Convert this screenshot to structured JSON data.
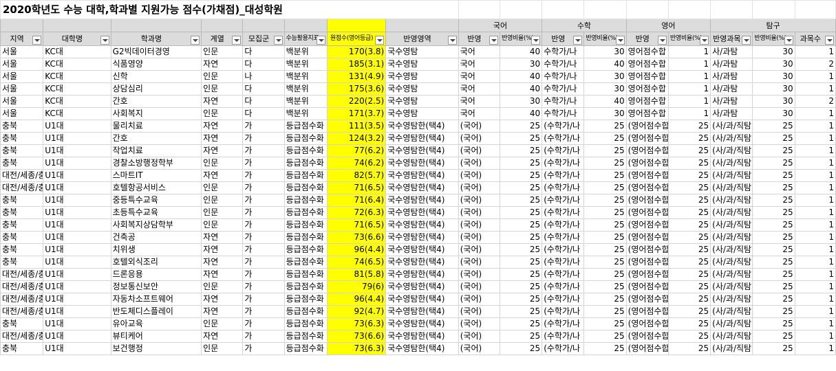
{
  "title": "2020학년도 수능 대학,학과별 지원가능 점수(가채점)_대성학원",
  "group_headers": {
    "korean": "국어",
    "math": "수학",
    "english": "영어",
    "inquiry": "탐구"
  },
  "column_headers": {
    "region": "지역",
    "university": "대학명",
    "department": "학과명",
    "track": "계열",
    "group": "모집군",
    "csat_index": "수능활용지표",
    "raw_score": "원점수(영어등급)",
    "reflected_areas": "반영영역",
    "kor_reflect": "반영",
    "kor_ratio": "반영비율(%)",
    "math_reflect": "반영",
    "math_ratio": "반영비율(%)",
    "eng_reflect": "반영",
    "eng_ratio": "반영비율(%)",
    "inq_subject": "반영과목",
    "inq_ratio": "반영비율(%)",
    "inq_count": "과목수"
  },
  "rows": [
    [
      "서울",
      "KC대",
      "G2빅데이터경영",
      "인문",
      "다",
      "백분위",
      "170(3.8)",
      "국수영탐",
      "국어",
      "40",
      "수학가/나",
      "30",
      "영어점수합",
      "1",
      "사/과탐",
      "30",
      "1"
    ],
    [
      "서울",
      "KC대",
      "식품영양",
      "자연",
      "다",
      "백분위",
      "185(3.1)",
      "국수영탐",
      "국어",
      "30",
      "수학가/나",
      "40",
      "영어점수합",
      "1",
      "사/과탐",
      "30",
      "2"
    ],
    [
      "서울",
      "KC대",
      "신학",
      "인문",
      "나",
      "백분위",
      "131(4.9)",
      "국수영탐",
      "국어",
      "40",
      "수학가/나",
      "30",
      "영어점수합",
      "1",
      "사/과탐",
      "30",
      "1"
    ],
    [
      "서울",
      "KC대",
      "상담심리",
      "인문",
      "다",
      "백분위",
      "175(3.6)",
      "국수영탐",
      "국어",
      "40",
      "수학가/나",
      "30",
      "영어점수합",
      "1",
      "사/과탐",
      "30",
      "1"
    ],
    [
      "서울",
      "KC대",
      "간호",
      "자연",
      "다",
      "백분위",
      "220(2.5)",
      "국수영탐",
      "국어",
      "30",
      "수학가/나",
      "40",
      "영어점수합",
      "1",
      "사/과탐",
      "30",
      "2"
    ],
    [
      "서울",
      "KC대",
      "사회복지",
      "인문",
      "다",
      "백분위",
      "171(3.7)",
      "국수영탐",
      "국어",
      "40",
      "수학가/나",
      "30",
      "영어점수합",
      "1",
      "사/과탐",
      "30",
      "1"
    ],
    [
      "충북",
      "U1대",
      "물리치료",
      "자연",
      "가",
      "등급점수화",
      "111(3.5)",
      "국수영탐한(택4)",
      "(국어)",
      "25",
      "(수학가/나",
      "25",
      "(영어점수합",
      "25",
      "(사/과/직탐",
      "25",
      "1"
    ],
    [
      "충북",
      "U1대",
      "간호",
      "자연",
      "가",
      "등급점수화",
      "124(3.2)",
      "국수영탐한(택4)",
      "(국어)",
      "25",
      "(수학가/나",
      "25",
      "(영어점수합",
      "25",
      "(사/과/직탐",
      "25",
      "1"
    ],
    [
      "충북",
      "U1대",
      "작업치료",
      "자연",
      "가",
      "등급점수화",
      "77(6.2)",
      "국수영탐한(택4)",
      "(국어)",
      "25",
      "(수학가/나",
      "25",
      "(영어점수합",
      "25",
      "(사/과/직탐",
      "25",
      "1"
    ],
    [
      "충북",
      "U1대",
      "경찰소방행정학부",
      "인문",
      "가",
      "등급점수화",
      "74(6.2)",
      "국수영탐한(택4)",
      "(국어)",
      "25",
      "(수학가/나",
      "25",
      "(영어점수합",
      "25",
      "(사/과/직탐",
      "25",
      "1"
    ],
    [
      "대전/세종/충남",
      "U1대",
      "스마트IT",
      "자연",
      "가",
      "등급점수화",
      "82(5.7)",
      "국수영탐한(택4)",
      "(국어)",
      "25",
      "(수학가/나",
      "25",
      "(영어점수합",
      "25",
      "(사/과/직탐",
      "25",
      "1"
    ],
    [
      "대전/세종/충남",
      "U1대",
      "호텔항공서비스",
      "인문",
      "가",
      "등급점수화",
      "71(6.5)",
      "국수영탐한(택4)",
      "(국어)",
      "25",
      "(수학가/나",
      "25",
      "(영어점수합",
      "25",
      "(사/과/직탐",
      "25",
      "1"
    ],
    [
      "충북",
      "U1대",
      "중등특수교육",
      "인문",
      "가",
      "등급점수화",
      "71(6.4)",
      "국수영탐한(택4)",
      "(국어)",
      "25",
      "(수학가/나",
      "25",
      "(영어점수합",
      "25",
      "(사/과/직탐",
      "25",
      "1"
    ],
    [
      "충북",
      "U1대",
      "초등특수교육",
      "인문",
      "가",
      "등급점수화",
      "72(6.3)",
      "국수영탐한(택4)",
      "(국어)",
      "25",
      "(수학가/나",
      "25",
      "(영어점수합",
      "25",
      "(사/과/직탐",
      "25",
      "1"
    ],
    [
      "충북",
      "U1대",
      "사회복지상담학부",
      "인문",
      "가",
      "등급점수화",
      "71(6.5)",
      "국수영탐한(택4)",
      "(국어)",
      "25",
      "(수학가/나",
      "25",
      "(영어점수합",
      "25",
      "(사/과/직탐",
      "25",
      "1"
    ],
    [
      "충북",
      "U1대",
      "건축공",
      "자연",
      "가",
      "등급점수화",
      "73(6.6)",
      "국수영탐한(택4)",
      "(국어)",
      "25",
      "(수학가/나",
      "25",
      "(영어점수합",
      "25",
      "(사/과/직탐",
      "25",
      "1"
    ],
    [
      "충북",
      "U1대",
      "치위생",
      "자연",
      "가",
      "등급점수화",
      "96(4.4)",
      "국수영탐한(택4)",
      "(국어)",
      "25",
      "(수학가/나",
      "25",
      "(영어점수합",
      "25",
      "(사/과/직탐",
      "25",
      "1"
    ],
    [
      "충북",
      "U1대",
      "호텔외식조리",
      "자연",
      "가",
      "등급점수화",
      "74(6.5)",
      "국수영탐한(택4)",
      "(국어)",
      "25",
      "(수학가/나",
      "25",
      "(영어점수합",
      "25",
      "(사/과/직탐",
      "25",
      "1"
    ],
    [
      "대전/세종/충남",
      "U1대",
      "드론응용",
      "자연",
      "가",
      "등급점수화",
      "81(5.8)",
      "국수영탐한(택4)",
      "(국어)",
      "25",
      "(수학가/나",
      "25",
      "(영어점수합",
      "25",
      "(사/과/직탐",
      "25",
      "1"
    ],
    [
      "대전/세종/충남",
      "U1대",
      "정보통신보안",
      "인문",
      "가",
      "등급점수화",
      "79(6)",
      "국수영탐한(택4)",
      "(국어)",
      "25",
      "(수학가/나",
      "25",
      "(영어점수합",
      "25",
      "(사/과/직탐",
      "25",
      "1"
    ],
    [
      "대전/세종/충남",
      "U1대",
      "자동차소프트웨어",
      "자연",
      "가",
      "등급점수화",
      "96(4.4)",
      "국수영탐한(택4)",
      "(국어)",
      "25",
      "(수학가/나",
      "25",
      "(영어점수합",
      "25",
      "(사/과/직탐",
      "25",
      "1"
    ],
    [
      "대전/세종/충남",
      "U1대",
      "반도체디스플레이",
      "자연",
      "가",
      "등급점수화",
      "92(4.7)",
      "국수영탐한(택4)",
      "(국어)",
      "25",
      "(수학가/나",
      "25",
      "(영어점수합",
      "25",
      "(사/과/직탐",
      "25",
      "1"
    ],
    [
      "충북",
      "U1대",
      "유아교육",
      "인문",
      "가",
      "등급점수화",
      "73(6.3)",
      "국수영탐한(택4)",
      "(국어)",
      "25",
      "(수학가/나",
      "25",
      "(영어점수합",
      "25",
      "(사/과/직탐",
      "25",
      "1"
    ],
    [
      "대전/세종/충남",
      "U1대",
      "뷰티케어",
      "자연",
      "가",
      "등급점수화",
      "73(6.6)",
      "국수영탐한(택4)",
      "(국어)",
      "25",
      "(수학가/나",
      "25",
      "(영어점수합",
      "25",
      "(사/과/직탐",
      "25",
      "1"
    ],
    [
      "충북",
      "U1대",
      "보건행정",
      "인문",
      "가",
      "등급점수화",
      "73(6.3)",
      "국수영탐한(택4)",
      "(국어)",
      "25",
      "(수학가/나",
      "25",
      "(영어점수합",
      "25",
      "(사/과/직탐",
      "25",
      "1"
    ]
  ],
  "colors": {
    "highlight": "#ffff00",
    "header_fill": "#dcdcdc",
    "gridline": "#d4d4d4"
  },
  "icons": {
    "filter": "filter-dropdown-icon"
  }
}
